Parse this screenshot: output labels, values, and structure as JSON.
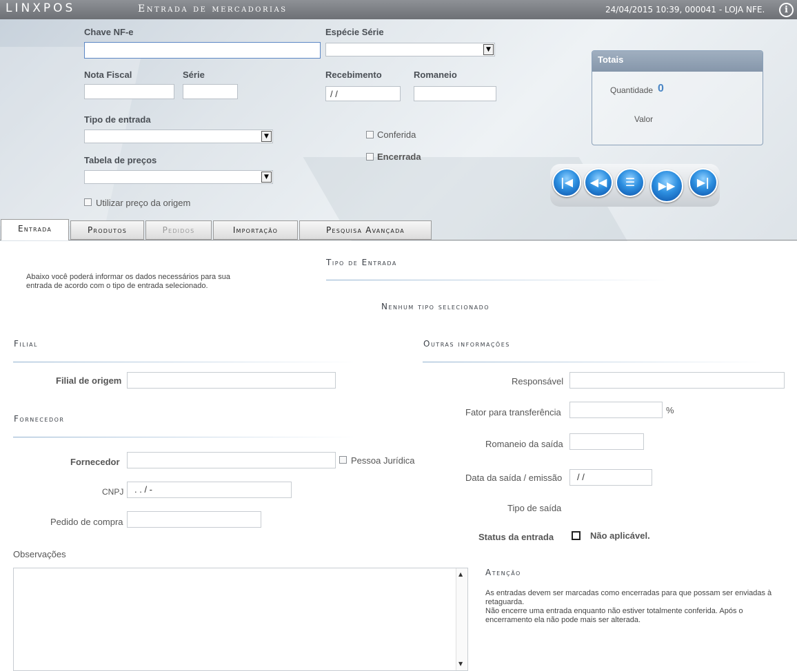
{
  "titlebar": {
    "logo": "LINXPOS",
    "title": "Entrada de mercadorias",
    "status": "24/04/2015 10:39, 000041 - LOJA NFE.",
    "info_icon": "i"
  },
  "header": {
    "chave_label": "Chave NF-e",
    "chave_value": "",
    "especie_label": "Espécie Série",
    "nota_label": "Nota Fiscal",
    "serie_label": "Série",
    "recebimento_label": "Recebimento",
    "recebimento_value": " / /",
    "romaneio_label": "Romaneio",
    "tipo_entrada_label": "Tipo de entrada",
    "tabela_label": "Tabela de preços",
    "utilizar_label": "Utilizar preço da origem",
    "conferida_label": "Conferida",
    "encerrada_label": "Encerrada"
  },
  "totals": {
    "title": "Totais",
    "quantidade_label": "Quantidade",
    "quantidade_value": "0",
    "valor_label": "Valor"
  },
  "tabs": [
    {
      "label": "Entrada"
    },
    {
      "label": "Produtos"
    },
    {
      "label": "Pedidos"
    },
    {
      "label": "Importação"
    },
    {
      "label": "Pesquisa Avançada"
    }
  ],
  "entrada": {
    "intro": "Abaixo você poderá informar os dados necessários para sua entrada de acordo com o tipo de entrada selecionado.",
    "tipo_title": "Tipo de Entrada",
    "nenhum": "Nenhum tipo selecionado",
    "filial_title": "Filial",
    "filial_origem_label": "Filial de origem",
    "fornecedor_title": "Fornecedor",
    "fornecedor_label": "Fornecedor",
    "pessoa_juridica_label": "Pessoa Jurídica",
    "cnpj_label": "CNPJ",
    "cnpj_value": " .  .  /   -",
    "pedido_label": "Pedido de compra",
    "observacoes_label": "Observações",
    "outras_title": "Outras informações",
    "responsavel_label": "Responsável",
    "fator_label": "Fator para transferência",
    "percent": "%",
    "romaneio_saida_label": "Romaneio da saída",
    "data_saida_label": "Data da saída / emissão",
    "data_saida_value": " / /",
    "tipo_saida_label": "Tipo de saída",
    "status_label": "Status da entrada",
    "status_value": "Não aplicável.",
    "atencao_title": "Atenção",
    "atencao_text1": "As entradas devem ser marcadas como encerradas para que possam ser enviadas à retaguarda.",
    "atencao_text2": "Não encerre uma entrada enquanto não estiver totalmente conferida. Após o encerramento ela não pode mais ser alterada."
  }
}
